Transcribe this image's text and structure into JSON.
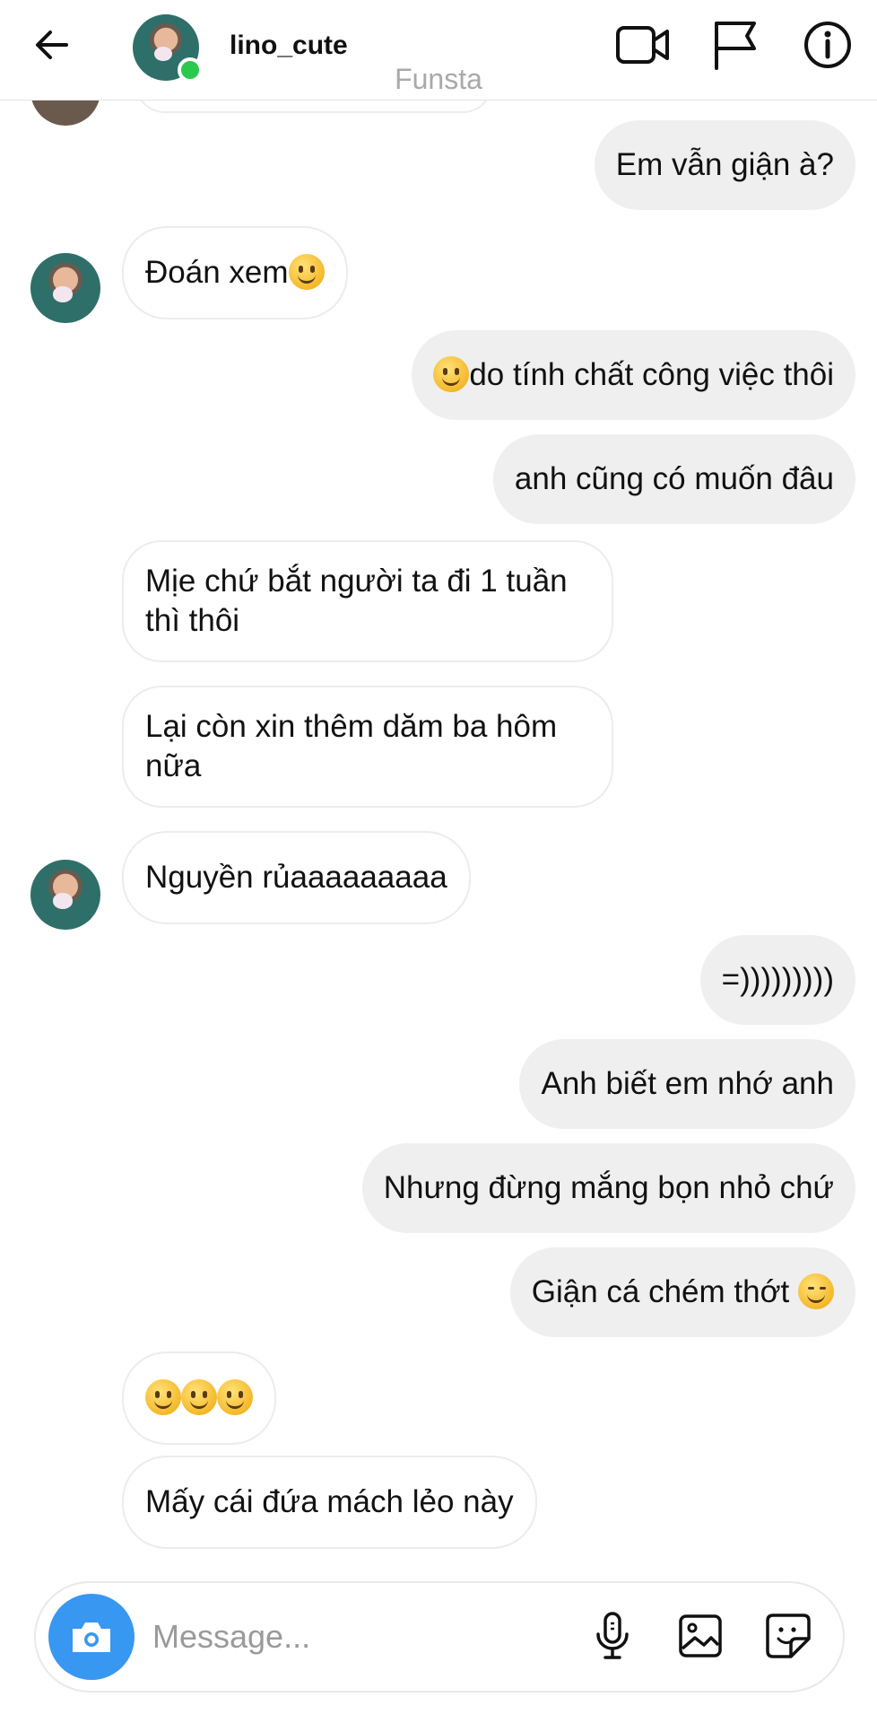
{
  "header": {
    "username": "lino_cute",
    "subtitle": "Funsta",
    "icons": [
      "back-arrow-icon",
      "video-call-icon",
      "flag-icon",
      "info-icon"
    ]
  },
  "messages": [
    {
      "side": "out",
      "text": "Em vẫn giận à?"
    },
    {
      "side": "in",
      "text": "Đoán xem",
      "emoji_after": 1,
      "avatar": true
    },
    {
      "side": "out",
      "text": "do tính chất công việc thôi",
      "emoji_before": 1
    },
    {
      "side": "out",
      "text": "anh cũng có muốn đâu"
    },
    {
      "side": "in",
      "text": "Mịe chứ bắt người ta đi 1 tuần thì thôi"
    },
    {
      "side": "in",
      "text": "Lại còn xin thêm dăm ba hôm nữa"
    },
    {
      "side": "in",
      "text": "Nguyền rủaaaaaaaaa",
      "avatar": true
    },
    {
      "side": "out",
      "text": "=)))))))))"
    },
    {
      "side": "out",
      "text": "Anh biết em nhớ anh"
    },
    {
      "side": "out",
      "text": "Nhưng đừng mắng bọn nhỏ chứ"
    },
    {
      "side": "out",
      "text": "Giận cá chém thớt",
      "emoji_after": "relieved"
    },
    {
      "side": "in",
      "text": "",
      "emoji_count": 3
    },
    {
      "side": "in",
      "text": "Mấy cái đứa mách lẻo này"
    }
  ],
  "composer": {
    "placeholder": "Message...",
    "icons": [
      "camera-icon",
      "microphone-icon",
      "gallery-icon",
      "sticker-icon"
    ]
  },
  "colors": {
    "accent": "#3897f0",
    "online": "#2cc84d",
    "outgoing_bubble": "#efefef"
  }
}
